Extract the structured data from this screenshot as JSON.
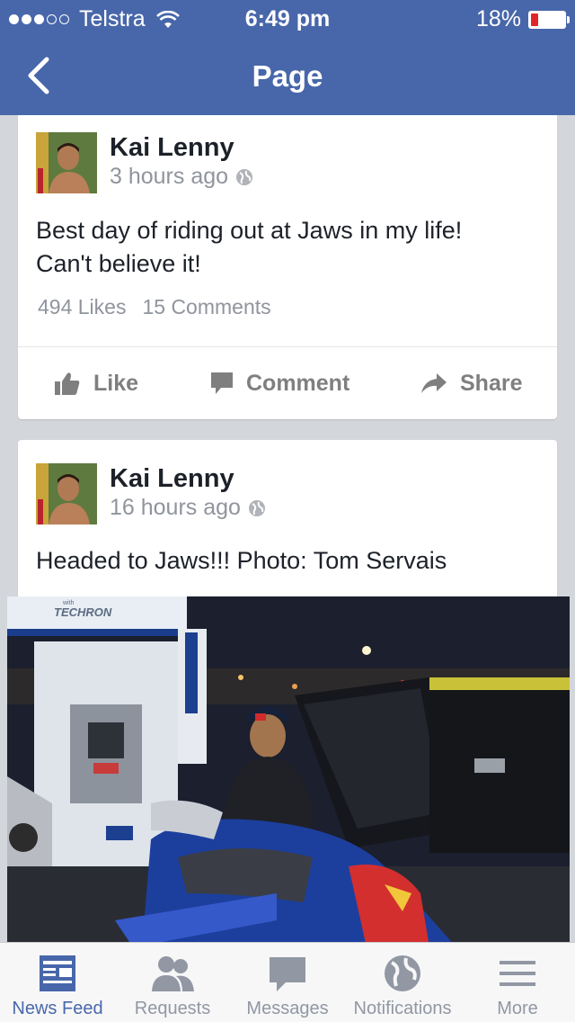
{
  "status_bar": {
    "carrier": "Telstra",
    "time": "6:49 pm",
    "battery": "18%",
    "battery_level": 0.18
  },
  "nav": {
    "title": "Page"
  },
  "posts": [
    {
      "author": "Kai Lenny",
      "time": "3 hours ago",
      "text_lines": [
        "Best day of riding out at Jaws in my life!",
        "Can't believe it!"
      ],
      "likes": "494 Likes",
      "comments": "15 Comments",
      "actions": {
        "like": "Like",
        "comment": "Comment",
        "share": "Share"
      }
    },
    {
      "author": "Kai Lenny",
      "time": "16 hours ago",
      "text": "Headed to Jaws!!! Photo: Tom Servais",
      "photo_sign": "TECHRON",
      "photo_sign_small": "with"
    }
  ],
  "tabs": [
    {
      "label": "News Feed",
      "icon": "news-feed-icon",
      "active": true
    },
    {
      "label": "Requests",
      "icon": "friend-requests-icon",
      "active": false
    },
    {
      "label": "Messages",
      "icon": "messages-icon",
      "active": false
    },
    {
      "label": "Notifications",
      "icon": "globe-icon",
      "active": false
    },
    {
      "label": "More",
      "icon": "menu-icon",
      "active": false
    }
  ],
  "colors": {
    "brand": "#4867aa",
    "secondary_text": "#90949c",
    "tab_inactive": "#9197a3"
  }
}
